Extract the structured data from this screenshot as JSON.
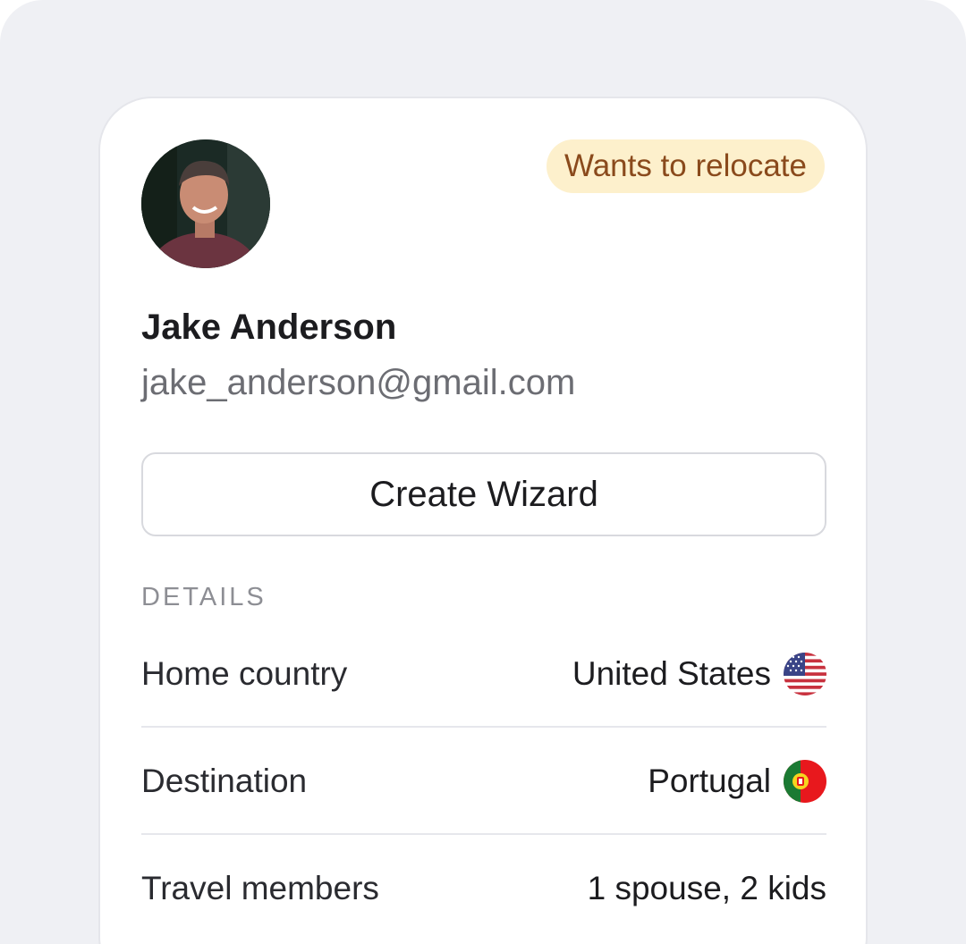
{
  "profile": {
    "name": "Jake Anderson",
    "email": "jake_anderson@gmail.com",
    "status_badge": "Wants to relocate"
  },
  "actions": {
    "create_wizard_label": "Create Wizard"
  },
  "details": {
    "section_title": "DETAILS",
    "rows": [
      {
        "label": "Home country",
        "value": "United States",
        "flag_icon": "us-flag-icon"
      },
      {
        "label": "Destination",
        "value": "Portugal",
        "flag_icon": "portugal-flag-icon"
      },
      {
        "label": "Travel members",
        "value": "1 spouse, 2 kids"
      }
    ]
  },
  "colors": {
    "badge_background": "#fdf0cc",
    "badge_text": "#8a4a1c",
    "page_background": "#eff0f4"
  }
}
